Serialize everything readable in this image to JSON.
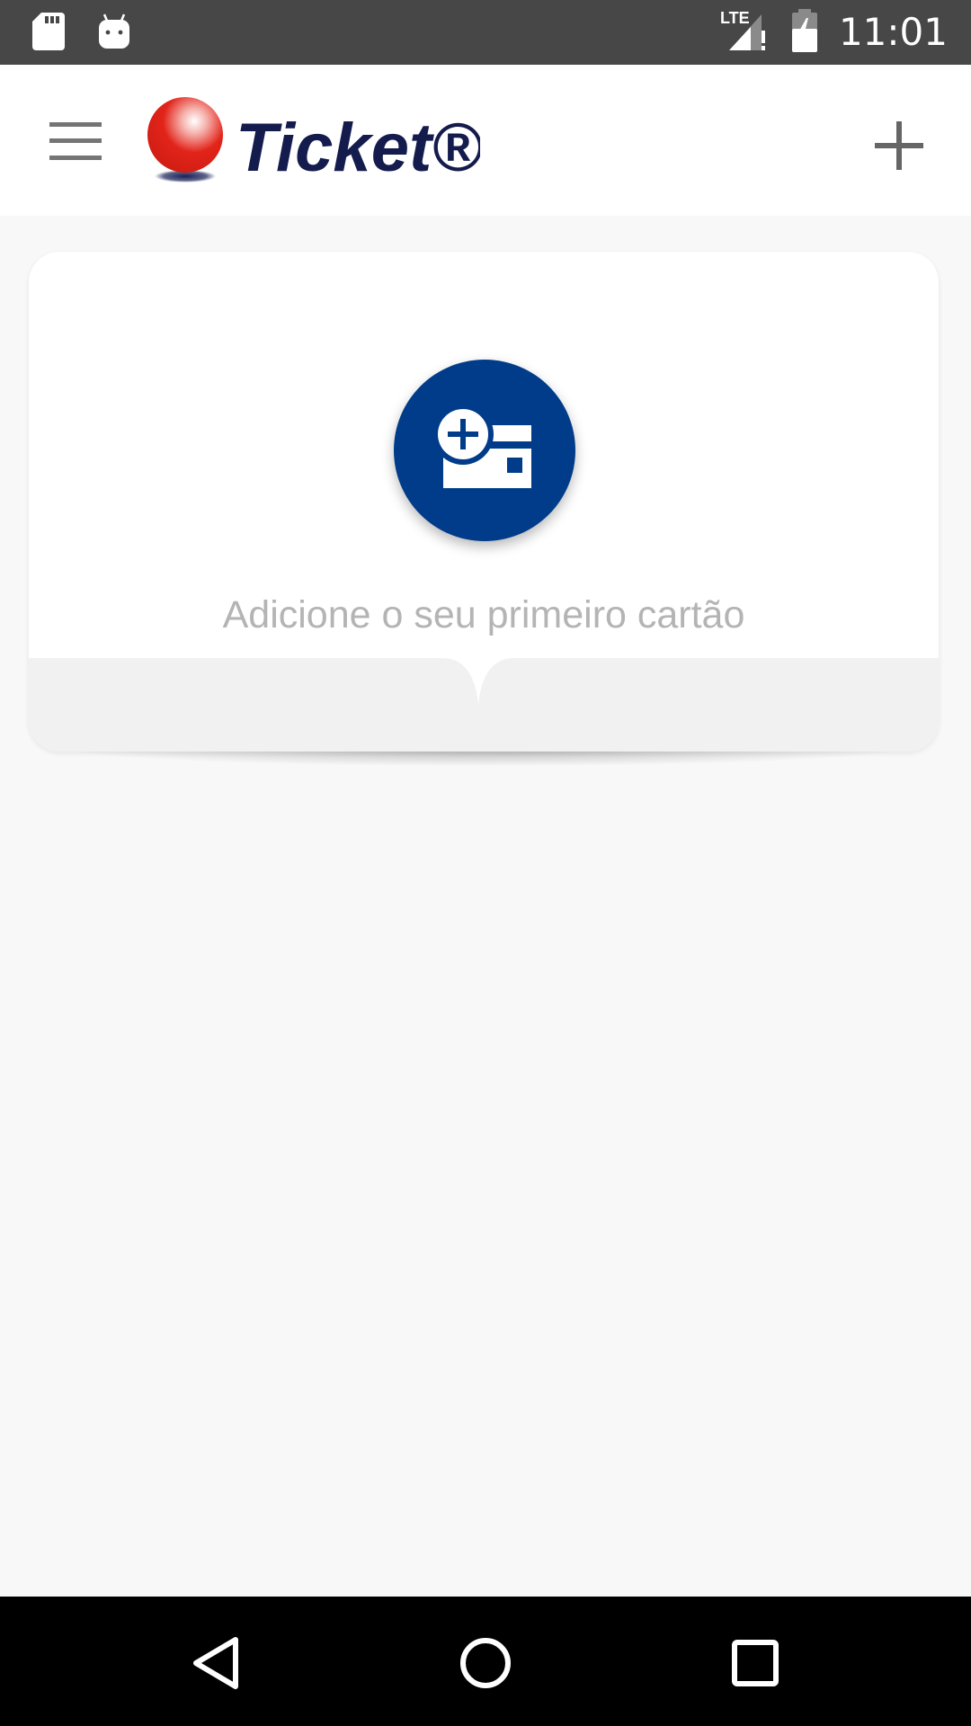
{
  "status_bar": {
    "time": "11:01",
    "network": "LTE",
    "icons": [
      "sd-card-icon",
      "android-icon",
      "signal-icon",
      "battery-charging-icon"
    ]
  },
  "app_bar": {
    "logo_text": "Ticket®",
    "menu_icon": "hamburger-menu-icon",
    "add_icon": "plus-icon"
  },
  "card": {
    "message": "Adicione o seu primeiro cartão",
    "icon": "add-card-icon",
    "accent_color": "#003c8a"
  },
  "nav_bar": {
    "icons": [
      "back-icon",
      "home-icon",
      "recents-icon"
    ]
  }
}
